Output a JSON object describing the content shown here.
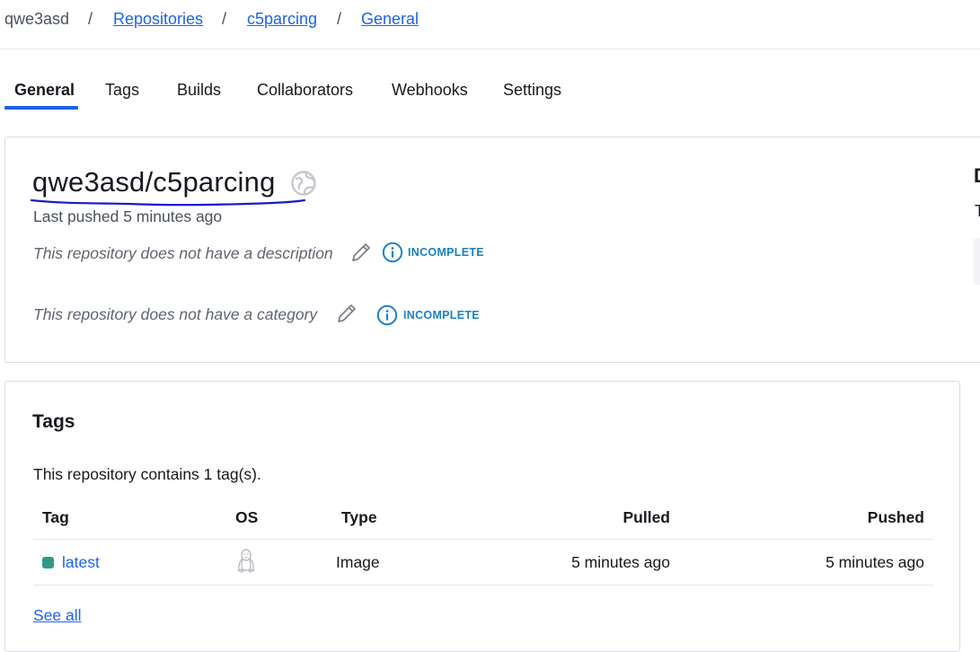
{
  "breadcrumb": {
    "user": "qwe3asd",
    "repositories": "Repositories",
    "repo": "c5parcing",
    "current": "General",
    "separator": "/"
  },
  "tabs": [
    {
      "label": "General",
      "active": true
    },
    {
      "label": "Tags",
      "active": false
    },
    {
      "label": "Builds",
      "active": false
    },
    {
      "label": "Collaborators",
      "active": false
    },
    {
      "label": "Webhooks",
      "active": false
    },
    {
      "label": "Settings",
      "active": false
    }
  ],
  "repo": {
    "title": "qwe3asd/c5parcing",
    "visibility_icon": "globe-icon",
    "last_pushed": "Last pushed 5 minutes ago",
    "description_text": "This repository does not have a description",
    "category_text": "This repository does not have a category",
    "incomplete_label": "INCOMPLETE"
  },
  "side_panel_peek": {
    "heading_initial": "D",
    "text_initial": "T"
  },
  "tags_section": {
    "heading": "Tags",
    "count_text": "This repository contains 1 tag(s).",
    "columns": [
      "Tag",
      "OS",
      "Type",
      "Pulled",
      "Pushed"
    ],
    "rows": [
      {
        "tag": "latest",
        "os_icon": "linux-icon",
        "type": "Image",
        "pulled": "5 minutes ago",
        "pushed": "5 minutes ago",
        "status_color": "#2e9a84"
      }
    ],
    "see_all": "See all"
  },
  "colors": {
    "accent": "#1d63ed",
    "incomplete": "#1d81c4",
    "border": "#dadde2",
    "annotation_ink": "#1a1acc"
  }
}
